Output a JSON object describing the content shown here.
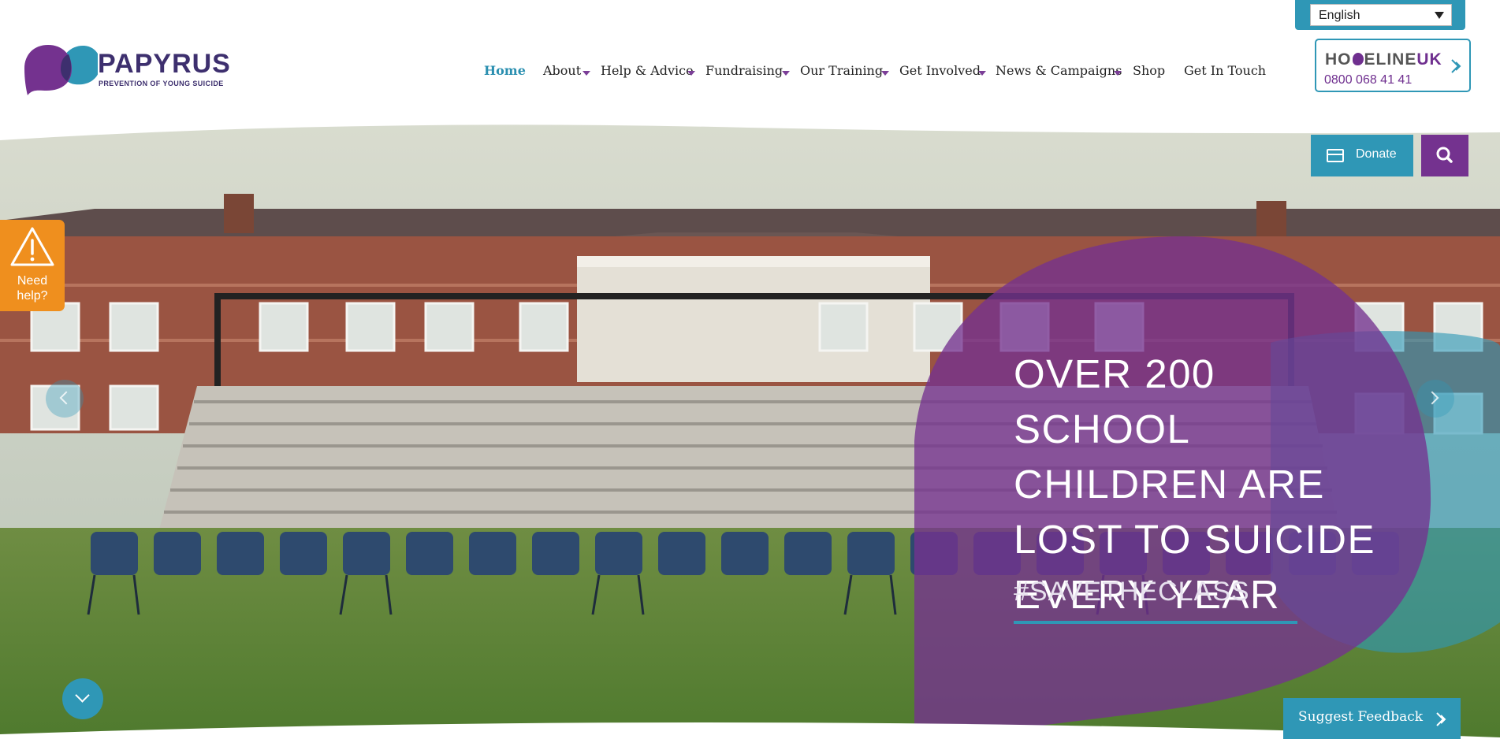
{
  "header": {
    "language": {
      "selected": "English"
    },
    "logo": {
      "name": "PAPYRUS",
      "tagline": "PREVENTION OF YOUNG SUICIDE"
    },
    "nav": [
      {
        "label": "Home",
        "active": true,
        "dropdown": false
      },
      {
        "label": "About",
        "active": false,
        "dropdown": true
      },
      {
        "label": "Help & Advice",
        "active": false,
        "dropdown": true
      },
      {
        "label": "Fundraising",
        "active": false,
        "dropdown": true
      },
      {
        "label": "Our Training",
        "active": false,
        "dropdown": true
      },
      {
        "label": "Get Involved",
        "active": false,
        "dropdown": true
      },
      {
        "label": "News & Campaigns",
        "active": false,
        "dropdown": true
      },
      {
        "label": "Shop",
        "active": false,
        "dropdown": false
      },
      {
        "label": "Get In Touch",
        "active": false,
        "dropdown": false
      }
    ],
    "hopeline": {
      "logo_part1": "HO",
      "logo_part2": "ELINE",
      "logo_part3": "UK",
      "phone": "0800 068 41 41"
    }
  },
  "actions": {
    "donate_label": "Donate",
    "search_icon": "search-icon"
  },
  "need_help": {
    "line1": "Need",
    "line2": "help?"
  },
  "hero": {
    "lines": [
      "OVER 200 SCHOOL",
      "CHILDREN ARE",
      "LOST TO SUICIDE",
      "EVERY YEAR"
    ],
    "hashtag": "#SAVETHECLASS"
  },
  "feedback": {
    "label": "Suggest Feedback"
  },
  "colors": {
    "teal": "#2f97b6",
    "purple": "#74328f",
    "orange": "#ef8f1e",
    "navy": "#3d2f6e"
  }
}
